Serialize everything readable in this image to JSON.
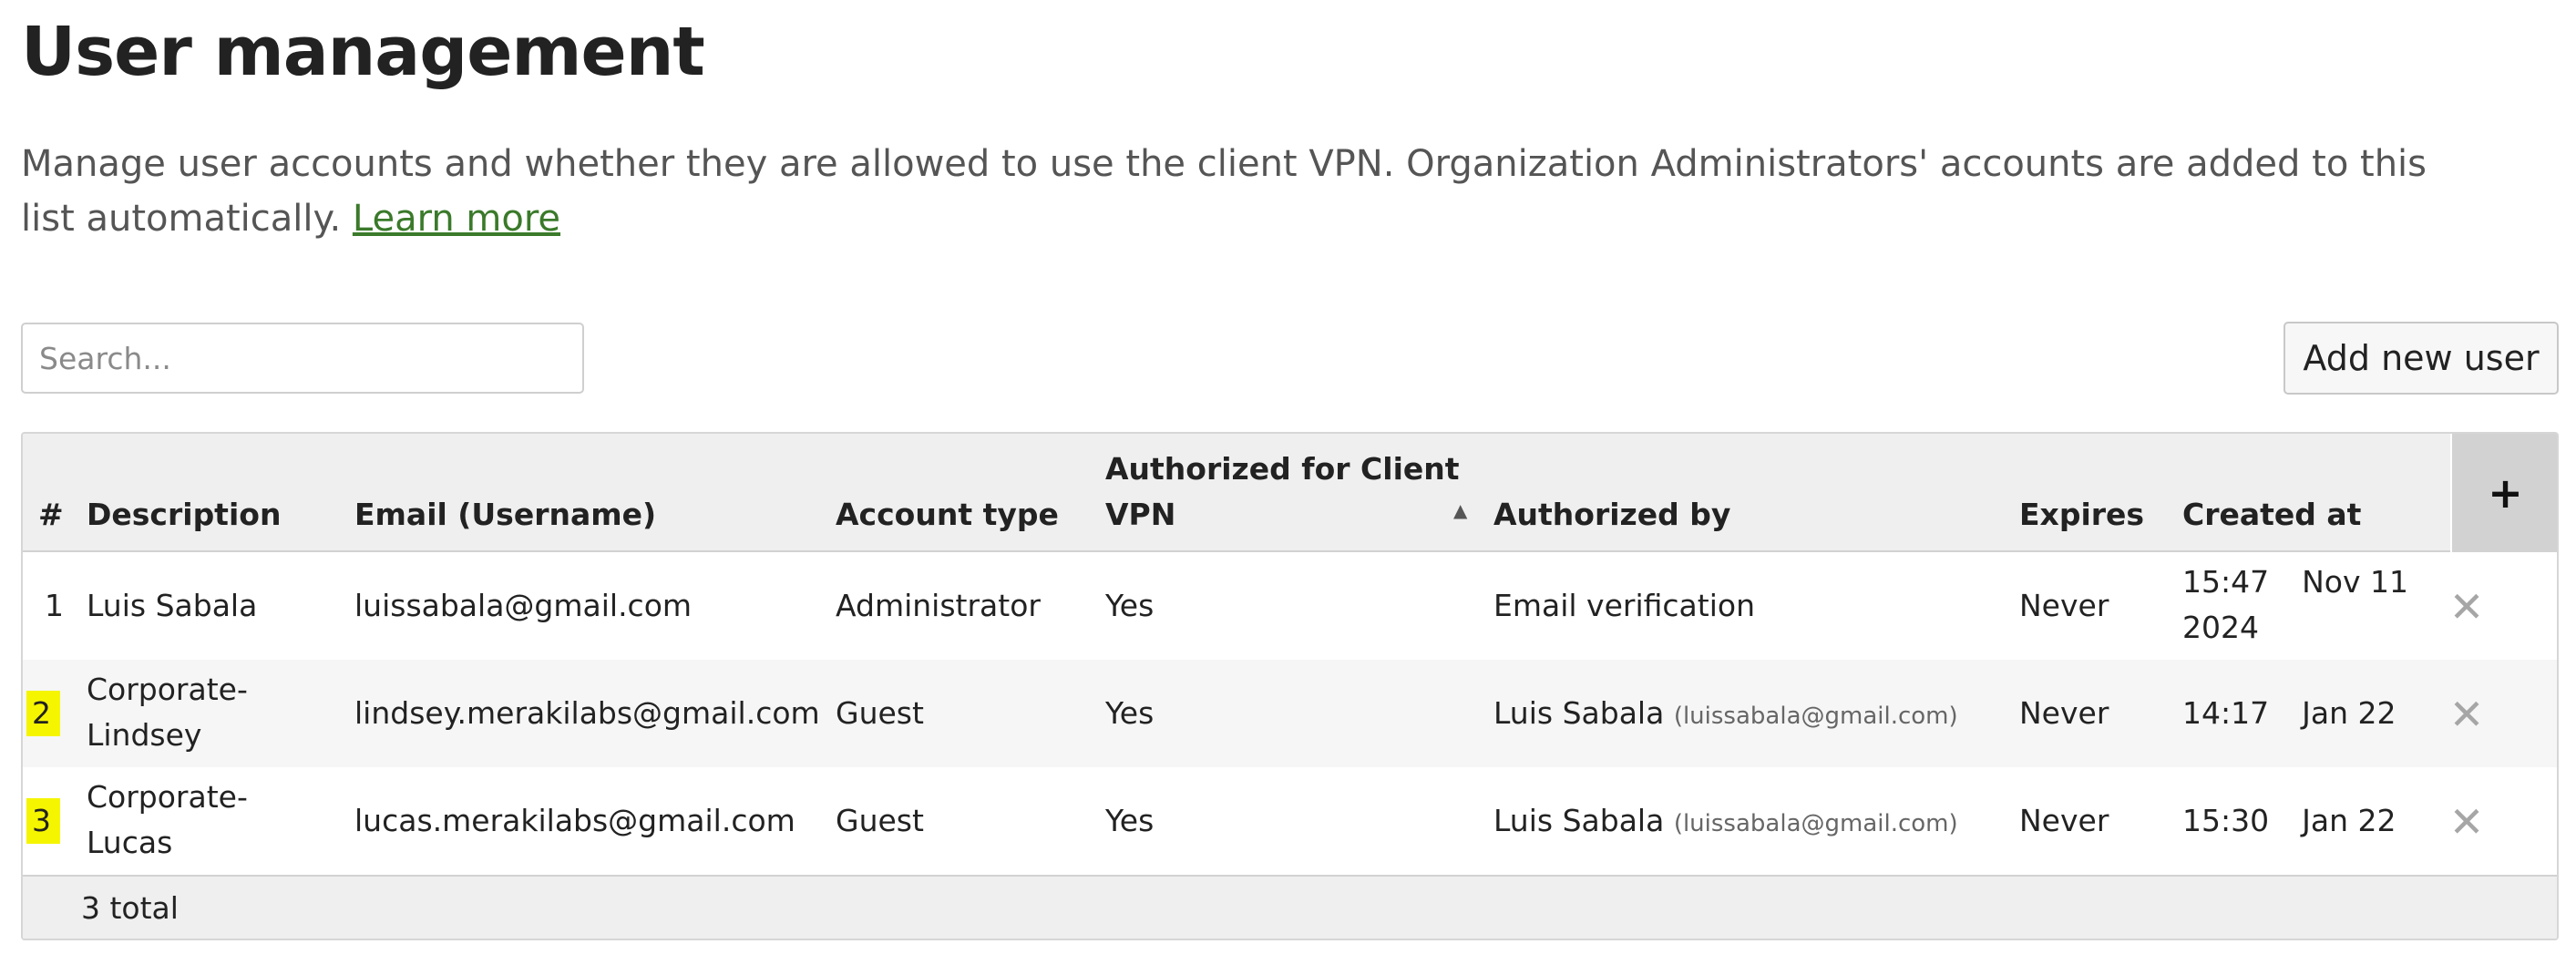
{
  "page": {
    "title": "User management",
    "description": "Manage user accounts and whether they are allowed to use the client VPN. Organization Administrators' accounts are added to this list automatically.",
    "learn_more": "Learn more"
  },
  "search": {
    "placeholder": "Search...",
    "value": ""
  },
  "add_button": "Add new user",
  "table": {
    "headers": {
      "index": "#",
      "description": "Description",
      "email": "Email (Username)",
      "account_type": "Account type",
      "vpn_line1": "Authorized for Client",
      "vpn_line2": "VPN",
      "authorized_by": "Authorized by",
      "expires": "Expires",
      "created_at": "Created at"
    },
    "sort_icon": "sort-ascending-icon",
    "add_column_icon": "plus-icon",
    "add_column_label": "+",
    "delete_icon": "close-icon",
    "delete_label": "✕",
    "rows": [
      {
        "index": "1",
        "description": "Luis Sabala",
        "email": "luissabala@gmail.com",
        "account_type": "Administrator",
        "vpn": "Yes",
        "authorized_by": "Email verification",
        "authorized_by_email": "",
        "expires": "Never",
        "created_time": "15:47",
        "created_date": "Nov 11",
        "created_year": "2024"
      },
      {
        "index": "2",
        "description_line1": "Corporate-",
        "description_line2": "Lindsey",
        "email": "lindsey.merakilabs@gmail.com",
        "account_type": "Guest",
        "vpn": "Yes",
        "authorized_by": "Luis Sabala",
        "authorized_by_email": "(luissabala@gmail.com)",
        "expires": "Never",
        "created_time": "14:17",
        "created_date": "Jan 22"
      },
      {
        "index": "3",
        "description_line1": "Corporate-",
        "description_line2": "Lucas",
        "email": "lucas.merakilabs@gmail.com",
        "account_type": "Guest",
        "vpn": "Yes",
        "authorized_by": "Luis Sabala",
        "authorized_by_email": "(luissabala@gmail.com)",
        "expires": "Never",
        "created_time": "15:30",
        "created_date": "Jan 22"
      }
    ],
    "footer_total": "3 total"
  },
  "colors": {
    "link": "#3a7a2a",
    "highlight": "#f5f500",
    "header_bg": "#efefef",
    "plus_bg": "#d2d2d2"
  }
}
